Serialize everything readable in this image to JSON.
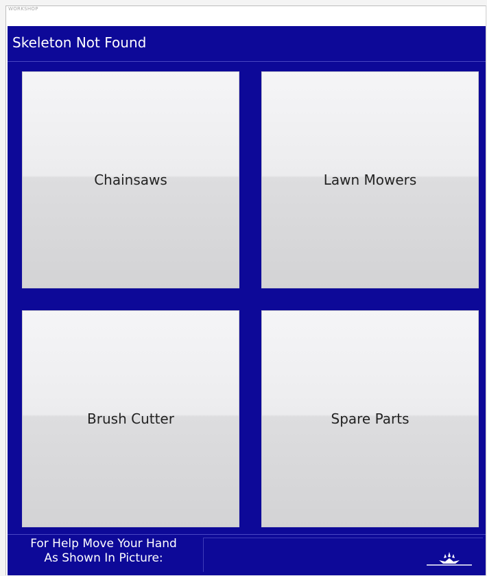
{
  "window": {
    "title": "WORKSHOP"
  },
  "header": {
    "title": "Skeleton Not Found"
  },
  "tiles": [
    {
      "label": "Chainsaws"
    },
    {
      "label": "Lawn Mowers"
    },
    {
      "label": "Brush Cutter"
    },
    {
      "label": "Spare Parts"
    }
  ],
  "footer": {
    "help_line_1": "For Help Move Your Hand",
    "help_line_2": "As Shown In Picture:",
    "gesture_icon": "raised-hand-figure-icon"
  },
  "colors": {
    "background": "#0d0998",
    "tile_top": "#f5f5f7",
    "tile_bottom": "#d3d3d5",
    "text_light": "#ffffff",
    "text_dark": "#222222"
  }
}
